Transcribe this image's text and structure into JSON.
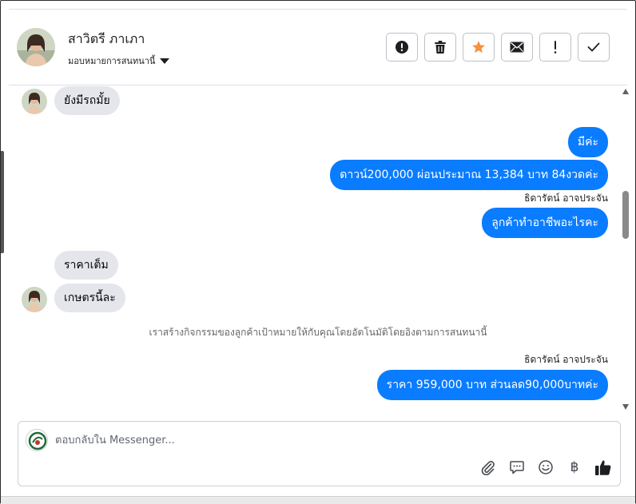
{
  "header": {
    "contact_name": "สาวิตรี ภาเภา",
    "assign_label": "มอบหมายการสนทนานี้"
  },
  "actions": [
    {
      "name": "spam-button",
      "icon": "alert-circle-icon"
    },
    {
      "name": "delete-button",
      "icon": "trash-icon"
    },
    {
      "name": "star-button",
      "icon": "star-icon",
      "color": "#f7923b"
    },
    {
      "name": "mark-unread-button",
      "icon": "envelope-icon"
    },
    {
      "name": "follow-up-button",
      "icon": "exclamation-icon"
    },
    {
      "name": "mark-done-button",
      "icon": "check-icon"
    }
  ],
  "messages": [
    {
      "dir": "in",
      "text": "ยังมีรถมั้ย"
    },
    {
      "dir": "out",
      "text": "มีค่ะ"
    },
    {
      "dir": "out",
      "text": "ดาวน์200,000 ผ่อนประมาณ 13,384 บาท 84งวดค่ะ"
    },
    {
      "dir": "sender",
      "text": "ธิดารัตน์ อาจประจัน"
    },
    {
      "dir": "out",
      "text": "ลูกค้าทำอาชีพอะไรคะ"
    },
    {
      "dir": "in",
      "text": "ราคาเต็ม"
    },
    {
      "dir": "in",
      "text": "เกษตรนี้ละ"
    },
    {
      "dir": "system",
      "text": "เราสร้างกิจกรรมของลูกค้าเป้าหมายให้กับคุณโดยอัตโนมัติโดยอิงตามการสนทนานี้"
    },
    {
      "dir": "sender",
      "text": "ธิดารัตน์ อาจประจัน"
    },
    {
      "dir": "out",
      "text": "ราคา 959,000 บาท ส่วนลด90,000บาทค่ะ"
    }
  ],
  "composer": {
    "placeholder": "ตอบกลับใน Messenger...",
    "value": ""
  },
  "tools": [
    "paperclip-icon",
    "comment-icon",
    "smiley-icon",
    "baht-icon",
    "thumbs-up-icon"
  ],
  "tool_glyphs": {
    "baht": "฿"
  },
  "colors": {
    "outgoing_bubble": "#0a7cff",
    "incoming_bubble": "#e4e6eb",
    "star": "#f7923b"
  }
}
